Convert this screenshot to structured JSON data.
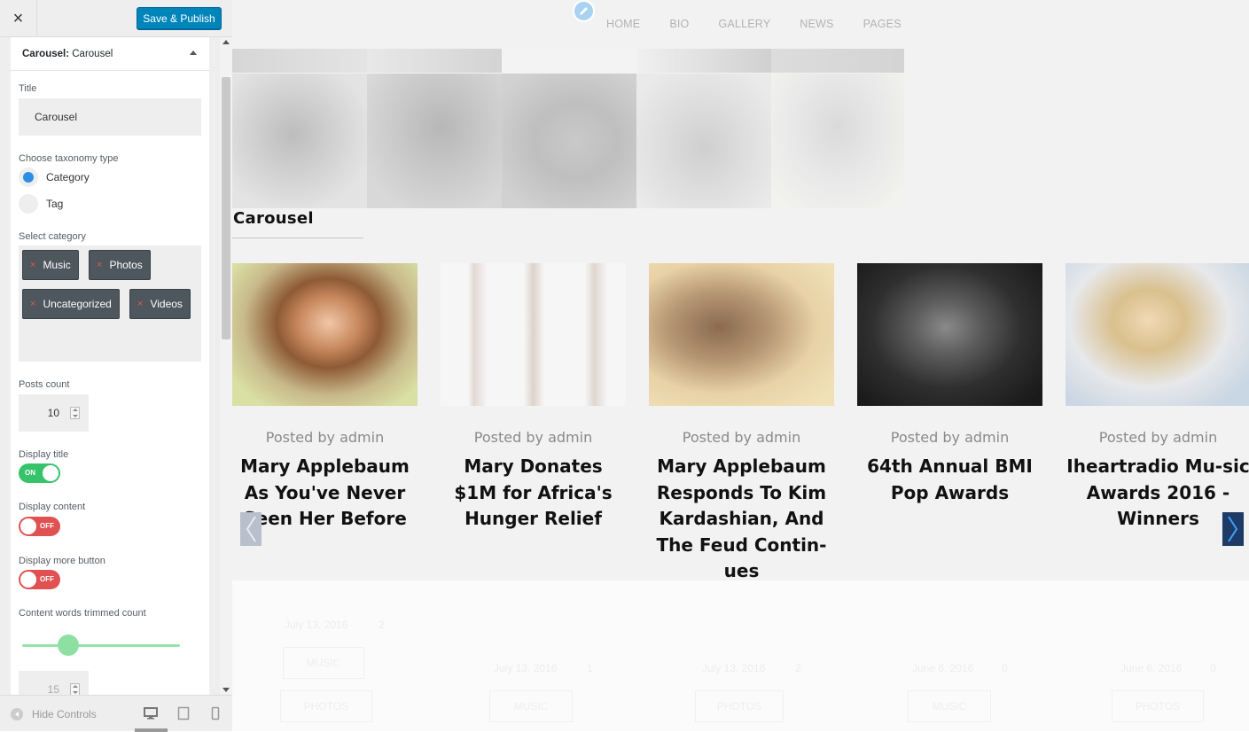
{
  "panel": {
    "close_label": "×",
    "save_label": "Save & Publish",
    "section_prefix": "Carousel: ",
    "section_name": "Carousel",
    "title_label": "Title",
    "title_value": "Carousel",
    "taxonomy_label": "Choose taxonomy type",
    "taxonomy_options": [
      "Category",
      "Tag"
    ],
    "taxonomy_selected": "Category",
    "category_label": "Select category",
    "categories": [
      "Music",
      "Photos",
      "Uncategorized",
      "Videos"
    ],
    "chip_remove": "×",
    "posts_count_label": "Posts count",
    "posts_count_value": "10",
    "display_title_label": "Display title",
    "display_title_state": "ON",
    "display_content_label": "Display content",
    "display_content_state": "OFF",
    "display_more_label": "Display more button",
    "display_more_state": "OFF",
    "trim_label": "Content words trimmed count",
    "trim_value": "15",
    "hide_controls_label": "Hide Controls",
    "devices": [
      "desktop-icon",
      "tablet-icon",
      "mobile-icon"
    ]
  },
  "preview": {
    "nav": [
      "HOME",
      "BIO",
      "GALLERY",
      "NEWS",
      "PAGES"
    ],
    "carousel_title": "Carousel",
    "posts": [
      {
        "meta": "Posted by admin",
        "title": "Mary Applebaum As You've Never Seen Her Before"
      },
      {
        "meta": "Posted by admin",
        "title": "Mary Donates $1M for Africa's Hunger Relief"
      },
      {
        "meta": "Posted by admin",
        "title": "Mary Applebaum Responds To Kim Kardashian, And The Feud Contin-ues"
      },
      {
        "meta": "Posted by admin",
        "title": "64th Annual BMI Pop Awards"
      },
      {
        "meta": "Posted by admin",
        "title": "Iheartradio Mu-sic Awards 2016 - Winners"
      }
    ],
    "below": {
      "dates": [
        "July 13, 2016",
        "July 13, 2016",
        "July 13, 2016",
        "June 6, 2016",
        "June 6, 2016"
      ],
      "counts": [
        "2",
        "1",
        "2",
        "0",
        "0"
      ],
      "tags": [
        "MUSIC",
        "PHOTOS",
        "MUSIC",
        "PHOTOS",
        "MUSIC",
        "PHOTOS"
      ]
    }
  },
  "colors": {
    "accent": "#0085ba",
    "toggle_on": "#36c36a",
    "toggle_off": "#e05252",
    "radio_selected": "#2e8ee6"
  }
}
